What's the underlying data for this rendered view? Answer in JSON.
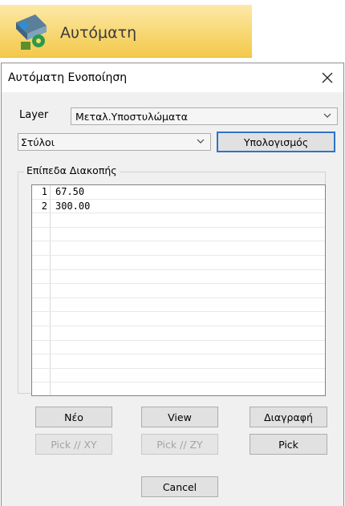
{
  "ribbon": {
    "label": "Αυτόματη",
    "icon": "columns-auto-icon"
  },
  "dialog": {
    "title": "Αυτόματη Ενοποίηση",
    "layer_label": "Layer",
    "layer_value": "Μεταλ.Υποστυλώματα",
    "type_value": "Στύλοι",
    "calc_button": "Υπολογισμός",
    "group_title": "Επίπεδα Διακοπής",
    "levels": [
      {
        "index": "1",
        "value": "67.50"
      },
      {
        "index": "2",
        "value": "300.00"
      }
    ],
    "buttons": {
      "new": "Νέο",
      "view": "View",
      "delete": "Διαγραφή",
      "pick_xy": "Pick // XY",
      "pick_zy": "Pick // ZY",
      "pick": "Pick",
      "cancel": "Cancel"
    }
  },
  "colors": {
    "ribbon_bg": "#f8d773",
    "default_button_border": "#2f73c8",
    "dialog_bg": "#f0f0f0"
  }
}
